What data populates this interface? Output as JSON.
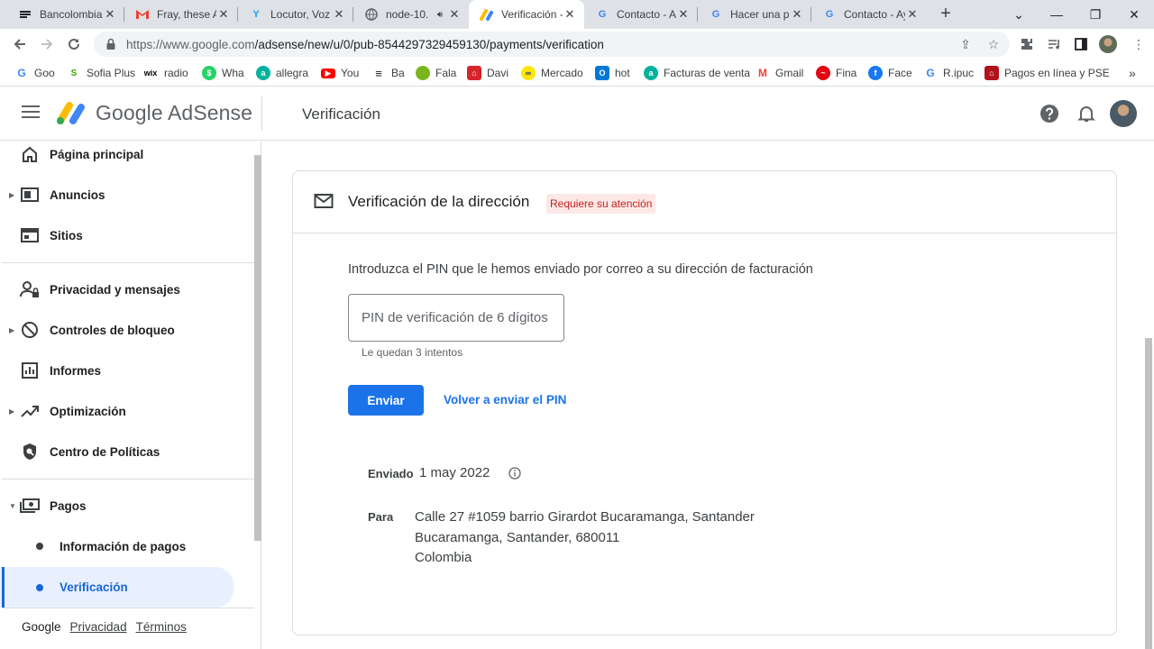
{
  "browser": {
    "tabs": [
      {
        "title": "Bancolombia",
        "icon": "bancolombia-icon",
        "active": false
      },
      {
        "title": "Fray, these Ad",
        "icon": "gmail-icon",
        "active": false
      },
      {
        "title": "Locutor, Voz d",
        "icon": "locutor-icon",
        "active": false
      },
      {
        "title": "node-10.",
        "icon": "globe-icon",
        "active": false
      },
      {
        "title": "Verificación -",
        "icon": "adsense-icon",
        "active": true
      },
      {
        "title": "Contacto - Ay",
        "icon": "google-icon",
        "active": false
      },
      {
        "title": "Hacer una pr",
        "icon": "google-icon",
        "active": false
      },
      {
        "title": "Contacto - Ay",
        "icon": "google-icon",
        "active": false
      }
    ],
    "url_host": "https://www.google.com",
    "url_path": "/adsense/new/u/0/pub-8544297329459130/payments/verification",
    "bookmarks": [
      {
        "label": "Goo",
        "color": "#4285f4"
      },
      {
        "label": "Sofia Plus",
        "color": "#39a900"
      },
      {
        "label": "radio",
        "color": "#000000"
      },
      {
        "label": "Wha",
        "color": "#25d366"
      },
      {
        "label": "allegra",
        "color": "#00b19d"
      },
      {
        "label": "You",
        "color": "#ff0000"
      },
      {
        "label": "Ba",
        "color": "#202124"
      },
      {
        "label": "Fala",
        "color": "#7ab51d"
      },
      {
        "label": "Davi",
        "color": "#d8232a"
      },
      {
        "label": "Mercado",
        "color": "#ffe600"
      },
      {
        "label": "hot",
        "color": "#0078d4"
      },
      {
        "label": "Facturas de venta",
        "color": "#00b19d"
      },
      {
        "label": "Gmail",
        "color": "#ea4335"
      },
      {
        "label": "Fina",
        "color": "#e30613"
      },
      {
        "label": "Face",
        "color": "#1877f2"
      },
      {
        "label": "R.ipuc",
        "color": "#4285f4"
      },
      {
        "label": "Pagos en línea y PSE",
        "color": "#b3121a"
      }
    ]
  },
  "header": {
    "brand": "Google AdSense",
    "title": "Verificación"
  },
  "sidebar": {
    "items": [
      {
        "label": "Página principal",
        "icon": "home-icon"
      },
      {
        "label": "Anuncios",
        "icon": "ads-icon"
      },
      {
        "label": "Sitios",
        "icon": "sites-icon"
      },
      {
        "label": "Privacidad y mensajes",
        "icon": "privacy-icon"
      },
      {
        "label": "Controles de bloqueo",
        "icon": "block-icon"
      },
      {
        "label": "Informes",
        "icon": "reports-icon"
      },
      {
        "label": "Optimización",
        "icon": "optimization-icon"
      },
      {
        "label": "Centro de Políticas",
        "icon": "policy-icon"
      },
      {
        "label": "Pagos",
        "icon": "payments-icon"
      },
      {
        "label": "Información de pagos",
        "icon": ""
      },
      {
        "label": "Verificación",
        "icon": ""
      }
    ],
    "footer": {
      "google": "Google",
      "privacy": "Privacidad",
      "terms": "Términos"
    }
  },
  "card": {
    "title": "Verificación de la dirección",
    "badge": "Requiere su atención",
    "intro": "Introduzca el PIN que le hemos enviado por correo a su dirección de facturación",
    "pin_placeholder": "PIN de verificación de 6 dígitos",
    "attempts": "Le quedan 3 intentos",
    "send_button": "Enviar",
    "resend_link": "Volver a enviar el PIN",
    "sent_label": "Enviado",
    "sent_date": "1 may 2022",
    "to_label": "Para",
    "address": [
      "Calle 27 #1059 barrio Girardot Bucaramanga, Santander",
      "Bucaramanga, Santander, 680011",
      "Colombia"
    ]
  },
  "colors": {
    "accent": "#1a73e8",
    "badge_bg": "#fce8e6",
    "badge_text": "#c5221f",
    "selected_bg": "#e8f0fe"
  }
}
